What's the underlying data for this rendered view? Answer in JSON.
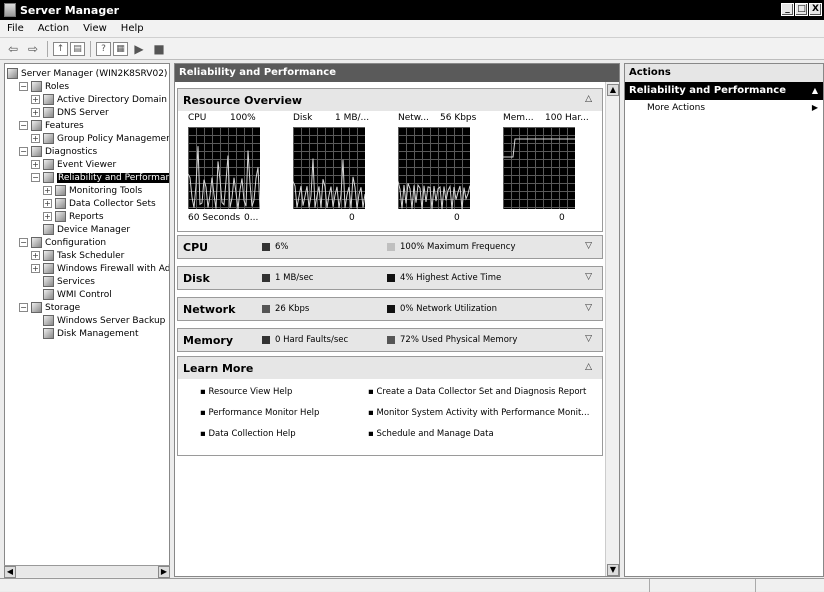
{
  "window": {
    "title": "Server Manager",
    "min": "_",
    "max": "□",
    "close": "X"
  },
  "menu": [
    "File",
    "Action",
    "View",
    "Help"
  ],
  "tree": [
    {
      "label": "Server Manager (WIN2K8SRV02)",
      "indent": 0,
      "exp": ""
    },
    {
      "label": "Roles",
      "indent": 1,
      "exp": "−"
    },
    {
      "label": "Active Directory Domain Se",
      "indent": 2,
      "exp": "+"
    },
    {
      "label": "DNS Server",
      "indent": 2,
      "exp": "+"
    },
    {
      "label": "Features",
      "indent": 1,
      "exp": "−"
    },
    {
      "label": "Group Policy Management",
      "indent": 2,
      "exp": "+"
    },
    {
      "label": "Diagnostics",
      "indent": 1,
      "exp": "−"
    },
    {
      "label": "Event Viewer",
      "indent": 2,
      "exp": "+"
    },
    {
      "label": "Reliability and Performance",
      "indent": 2,
      "exp": "−",
      "selected": true
    },
    {
      "label": "Monitoring Tools",
      "indent": 3,
      "exp": "+"
    },
    {
      "label": "Data Collector Sets",
      "indent": 3,
      "exp": "+"
    },
    {
      "label": "Reports",
      "indent": 3,
      "exp": "+"
    },
    {
      "label": "Device Manager",
      "indent": 2,
      "exp": ""
    },
    {
      "label": "Configuration",
      "indent": 1,
      "exp": "−"
    },
    {
      "label": "Task Scheduler",
      "indent": 2,
      "exp": "+"
    },
    {
      "label": "Windows Firewall with Adva",
      "indent": 2,
      "exp": "+"
    },
    {
      "label": "Services",
      "indent": 2,
      "exp": ""
    },
    {
      "label": "WMI Control",
      "indent": 2,
      "exp": ""
    },
    {
      "label": "Storage",
      "indent": 1,
      "exp": "−"
    },
    {
      "label": "Windows Server Backup",
      "indent": 2,
      "exp": ""
    },
    {
      "label": "Disk Management",
      "indent": 2,
      "exp": ""
    }
  ],
  "center": {
    "header": "Reliability and Performance",
    "overview": {
      "title": "Resource Overview",
      "graphs": [
        {
          "name": "CPU",
          "max": "100%",
          "footer_left": "60 Seconds",
          "footer_right": "0..."
        },
        {
          "name": "Disk",
          "max": "1 MB/...",
          "footer_left": "",
          "footer_right": "0"
        },
        {
          "name": "Netw...",
          "max": "56 Kbps",
          "footer_left": "",
          "footer_right": "0"
        },
        {
          "name": "Mem...",
          "max": "100 Har...",
          "footer_left": "",
          "footer_right": "0"
        }
      ]
    },
    "sections": [
      {
        "title": "CPU",
        "stat1": "6%",
        "stat2": "100% Maximum Frequency",
        "c1": "#333333",
        "c2": "#bfbfbf"
      },
      {
        "title": "Disk",
        "stat1": "1 MB/sec",
        "stat2": "4% Highest Active Time",
        "c1": "#333333",
        "c2": "#111111"
      },
      {
        "title": "Network",
        "stat1": "26 Kbps",
        "stat2": "0% Network Utilization",
        "c1": "#555555",
        "c2": "#111111"
      },
      {
        "title": "Memory",
        "stat1": "0 Hard Faults/sec",
        "stat2": "72% Used Physical Memory",
        "c1": "#333333",
        "c2": "#555555"
      }
    ],
    "learn_more": {
      "title": "Learn More",
      "links": [
        "Resource View Help",
        "Create a Data Collector Set and Diagnosis Report",
        "Performance Monitor Help",
        "Monitor System Activity with Performance Monit...",
        "Data Collection Help",
        "Schedule and Manage Data"
      ]
    }
  },
  "actions": {
    "title": "Actions",
    "group": "Reliability and Performance",
    "items": [
      "More Actions"
    ]
  }
}
